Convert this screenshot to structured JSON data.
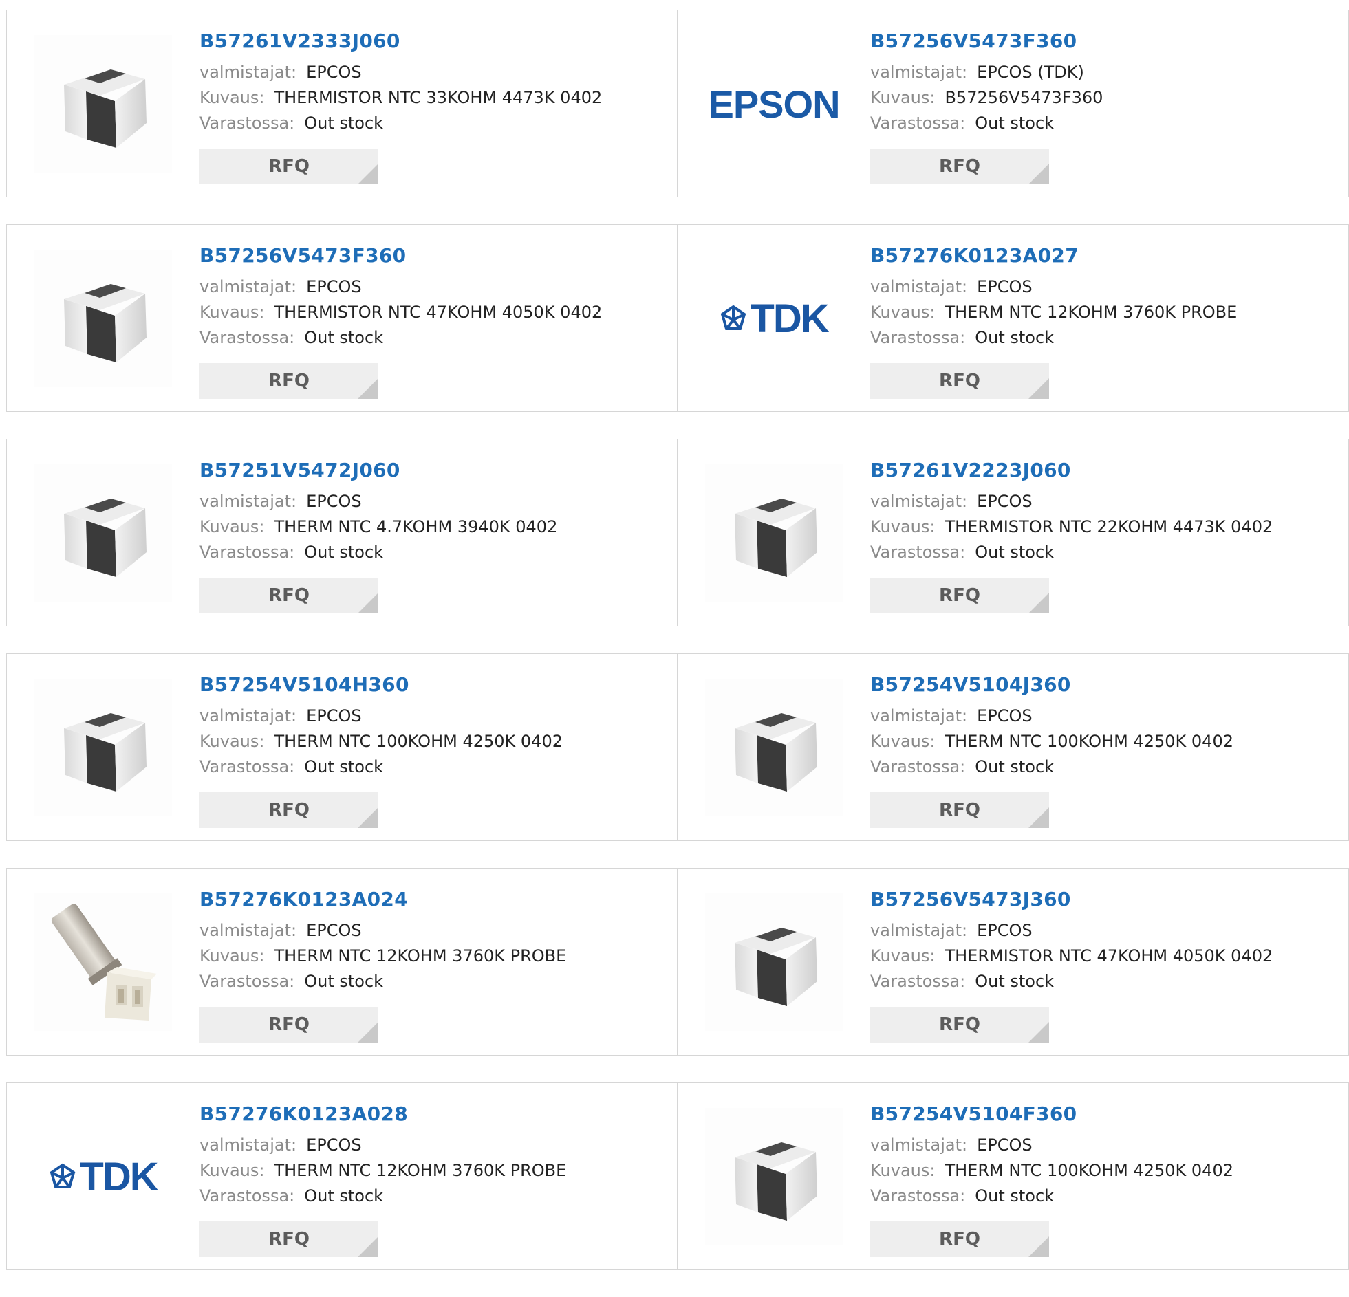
{
  "labels": {
    "manufacturer": "valmistajat:",
    "description": "Kuvaus:",
    "stock": "Varastossa:",
    "rfq": "RFQ"
  },
  "colors": {
    "link": "#1e6db7",
    "logo": "#1b5aa6",
    "rfq_bg": "#eeeeee"
  },
  "rows": [
    [
      {
        "part": "B57261V2333J060",
        "manufacturer": "EPCOS",
        "description": "THERMISTOR NTC 33KOHM 4473K 0402",
        "stock": "Out stock",
        "image": "chip-icon"
      },
      {
        "part": "B57256V5473F360",
        "manufacturer": "EPCOS (TDK)",
        "description": "B57256V5473F360",
        "stock": "Out stock",
        "image": "epson-logo",
        "logo_text": "EPSON"
      }
    ],
    [
      {
        "part": "B57256V5473F360",
        "manufacturer": "EPCOS",
        "description": "THERMISTOR NTC 47KOHM 4050K 0402",
        "stock": "Out stock",
        "image": "chip-icon"
      },
      {
        "part": "B57276K0123A027",
        "manufacturer": "EPCOS",
        "description": "THERM NTC 12KOHM 3760K PROBE",
        "stock": "Out stock",
        "image": "tdk-logo",
        "logo_text": "TDK"
      }
    ],
    [
      {
        "part": "B57251V5472J060",
        "manufacturer": "EPCOS",
        "description": "THERM NTC 4.7KOHM 3940K 0402",
        "stock": "Out stock",
        "image": "chip-icon"
      },
      {
        "part": "B57261V2223J060",
        "manufacturer": "EPCOS",
        "description": "THERMISTOR NTC 22KOHM 4473K 0402",
        "stock": "Out stock",
        "image": "chip-icon"
      }
    ],
    [
      {
        "part": "B57254V5104H360",
        "manufacturer": "EPCOS",
        "description": "THERM NTC 100KOHM 4250K 0402",
        "stock": "Out stock",
        "image": "chip-icon"
      },
      {
        "part": "B57254V5104J360",
        "manufacturer": "EPCOS",
        "description": "THERM NTC 100KOHM 4250K 0402",
        "stock": "Out stock",
        "image": "chip-icon"
      }
    ],
    [
      {
        "part": "B57276K0123A024",
        "manufacturer": "EPCOS",
        "description": "THERM NTC 12KOHM 3760K PROBE",
        "stock": "Out stock",
        "image": "probe-icon"
      },
      {
        "part": "B57256V5473J360",
        "manufacturer": "EPCOS",
        "description": "THERMISTOR NTC 47KOHM 4050K 0402",
        "stock": "Out stock",
        "image": "chip-icon"
      }
    ],
    [
      {
        "part": "B57276K0123A028",
        "manufacturer": "EPCOS",
        "description": "THERM NTC 12KOHM 3760K PROBE",
        "stock": "Out stock",
        "image": "tdk-logo",
        "logo_text": "TDK"
      },
      {
        "part": "B57254V5104F360",
        "manufacturer": "EPCOS",
        "description": "THERM NTC 100KOHM 4250K 0402",
        "stock": "Out stock",
        "image": "chip-icon"
      }
    ]
  ]
}
